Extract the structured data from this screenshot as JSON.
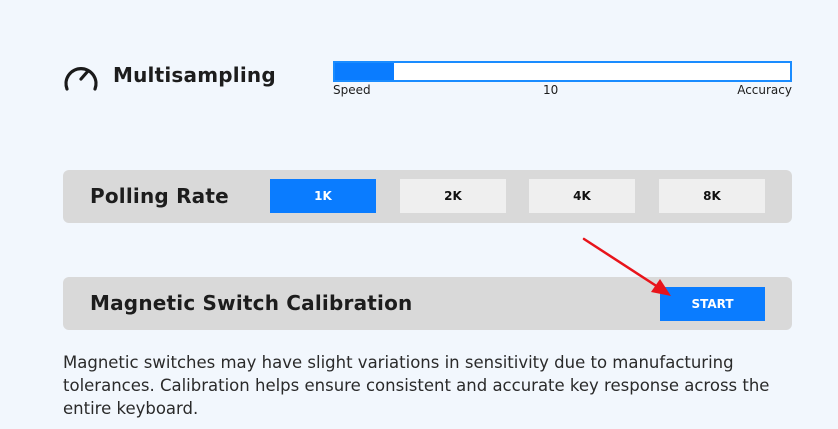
{
  "multisampling": {
    "icon": "speedometer-icon",
    "title": "Multisampling",
    "slider": {
      "left_label": "Speed",
      "value_label": "10",
      "right_label": "Accuracy",
      "fill_fraction": 0.13,
      "color": "#0a7cff"
    }
  },
  "polling": {
    "title": "Polling Rate",
    "options": [
      "1K",
      "2K",
      "4K",
      "8K"
    ],
    "selected": "1K"
  },
  "calibration": {
    "title": "Magnetic Switch Calibration",
    "start_label": "START",
    "description": "Magnetic switches may have slight variations in sensitivity due to manufacturing tolerances. Calibration helps ensure consistent and accurate key response across the entire keyboard."
  },
  "annotation": {
    "arrow_color": "#e8141b",
    "target": "start-button"
  }
}
